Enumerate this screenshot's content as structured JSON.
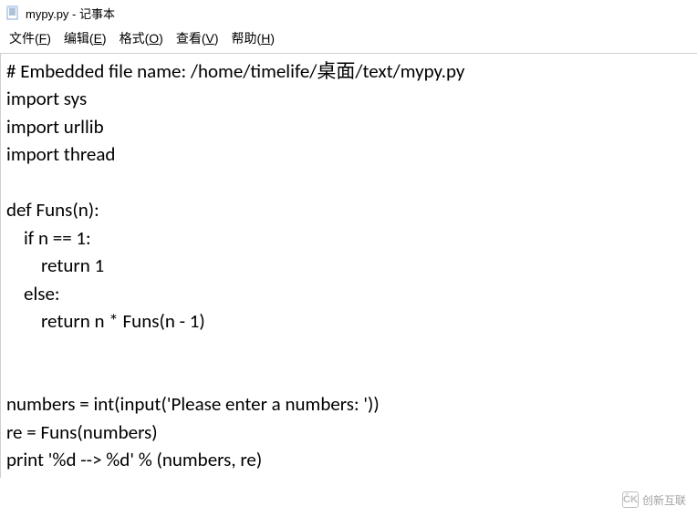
{
  "window": {
    "title": "mypy.py - 记事本"
  },
  "menu": {
    "file": {
      "label": "文件",
      "accel": "F"
    },
    "edit": {
      "label": "编辑",
      "accel": "E"
    },
    "format": {
      "label": "格式",
      "accel": "O"
    },
    "view": {
      "label": "查看",
      "accel": "V"
    },
    "help": {
      "label": "帮助",
      "accel": "H"
    }
  },
  "code_lines": [
    "# Embedded file name: /home/timelife/桌面/text/mypy.py",
    "import sys",
    "import urllib",
    "import thread",
    "",
    "def Funs(n):",
    "    if n == 1:",
    "        return 1",
    "    else:",
    "        return n * Funs(n - 1)",
    "",
    "",
    "numbers = int(input('Please enter a numbers: '))",
    "re = Funs(numbers)",
    "print '%d --> %d' % (numbers, re)"
  ],
  "watermark": {
    "text": "创新互联"
  }
}
